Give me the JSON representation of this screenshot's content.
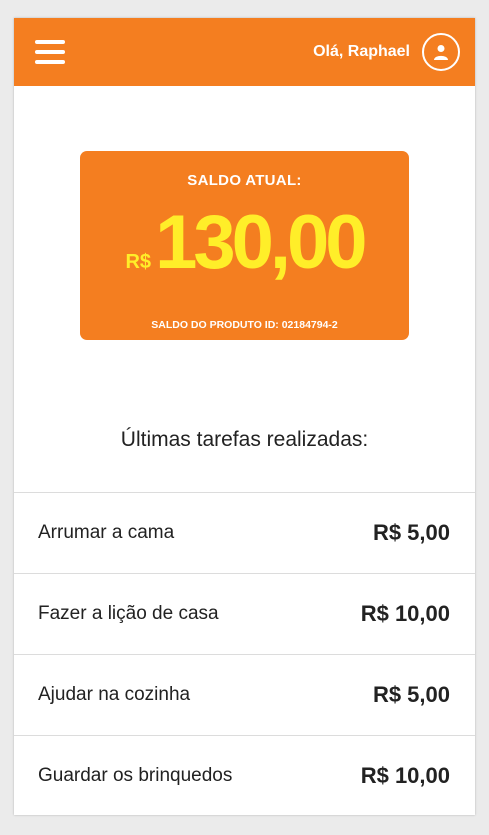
{
  "header": {
    "greeting": "Olá, Raphael",
    "menu_icon": "hamburger-menu-icon",
    "avatar_icon": "user-avatar-icon",
    "bg_color": "#f47e20"
  },
  "balance": {
    "label": "SALDO ATUAL:",
    "currency": "R$",
    "amount": "130,00",
    "product_id_text": "SALDO DO PRODUTO ID: 02184794-2",
    "amount_color": "#ffee29"
  },
  "tasks_section": {
    "title": "Últimas tarefas realizadas:",
    "items": [
      {
        "name": "Arrumar a cama",
        "value": "R$ 5,00"
      },
      {
        "name": "Fazer a lição de casa",
        "value": "R$ 10,00"
      },
      {
        "name": "Ajudar na cozinha",
        "value": "R$ 5,00"
      },
      {
        "name": "Guardar os brinquedos",
        "value": "R$ 10,00"
      }
    ]
  }
}
